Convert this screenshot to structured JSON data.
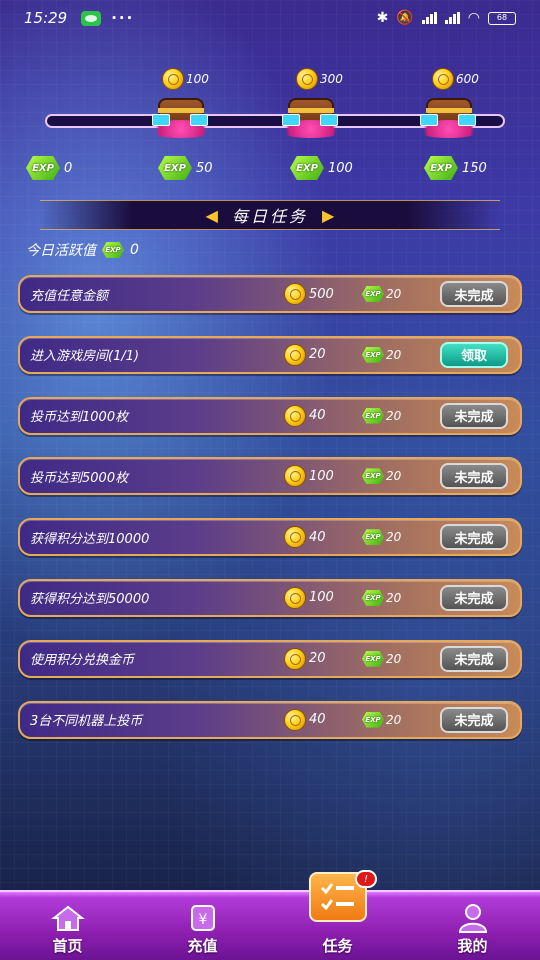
{
  "status_bar": {
    "time": "15:29",
    "more": "···",
    "battery": "68"
  },
  "milestones": [
    {
      "coins": "100",
      "exp": "50"
    },
    {
      "coins": "300",
      "exp": "100"
    },
    {
      "coins": "600",
      "exp": "150"
    }
  ],
  "progress": {
    "start_exp": "0",
    "fill_fraction": 0.0
  },
  "exp_badge": "EXP",
  "section_title": "每日任务",
  "activity": {
    "label": "今日活跃值",
    "value": "0"
  },
  "tasks": [
    {
      "name": "充值任意金额",
      "coins": "500",
      "exp": "20",
      "button": "未完成"
    },
    {
      "name": "进入游戏房间(1/1)",
      "coins": "20",
      "exp": "20",
      "button": "领取"
    },
    {
      "name": "投币达到1000枚",
      "coins": "40",
      "exp": "20",
      "button": "未完成"
    },
    {
      "name": "投币达到5000枚",
      "coins": "100",
      "exp": "20",
      "button": "未完成"
    },
    {
      "name": "获得积分达到10000",
      "coins": "40",
      "exp": "20",
      "button": "未完成"
    },
    {
      "name": "获得积分达到50000",
      "coins": "100",
      "exp": "20",
      "button": "未完成"
    },
    {
      "name": "使用积分兑换金币",
      "coins": "20",
      "exp": "20",
      "button": "未完成"
    },
    {
      "name": "3台不同机器上投币",
      "coins": "40",
      "exp": "20",
      "button": "未完成"
    }
  ],
  "nav": {
    "home": "首页",
    "recharge": "充值",
    "tasks": "任务",
    "mine": "我的",
    "tasks_badge": "!"
  }
}
